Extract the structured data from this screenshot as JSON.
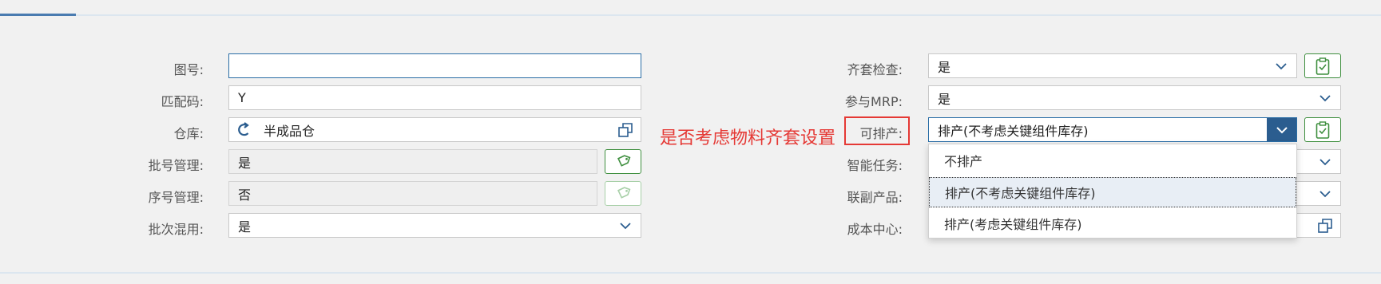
{
  "form": {
    "left": {
      "drawing_no": {
        "label": "图号:",
        "value": ""
      },
      "match_code": {
        "label": "匹配码:",
        "value": "Y"
      },
      "warehouse": {
        "label": "仓库:",
        "value": "半成品仓",
        "icon": "refresh-icon"
      },
      "batch_mgmt": {
        "label": "批号管理:",
        "value": "是"
      },
      "serial_mgmt": {
        "label": "序号管理:",
        "value": "否"
      },
      "batch_mix": {
        "label": "批次混用:",
        "value": "是"
      }
    },
    "right": {
      "kit_check": {
        "label": "齐套检查:",
        "value": "是"
      },
      "mrp": {
        "label": "参与MRP:",
        "value": "是"
      },
      "schedulable": {
        "label": "可排产:",
        "value": "排产(不考虑关键组件库存)"
      },
      "smart_task": {
        "label": "智能任务:"
      },
      "co_product": {
        "label": "联副产品:"
      },
      "cost_center": {
        "label": "成本中心:"
      }
    }
  },
  "annotation": {
    "text": "是否考虑物料齐套设置"
  },
  "dropdown": {
    "options": [
      "不排产",
      "排产(不考虑关键组件库存)",
      "排产(考虑关键组件库存)"
    ],
    "selected_index": 1
  },
  "colors": {
    "accent": "#2b5d8f",
    "annotation": "#e53935",
    "green": "#3f8f3f"
  }
}
